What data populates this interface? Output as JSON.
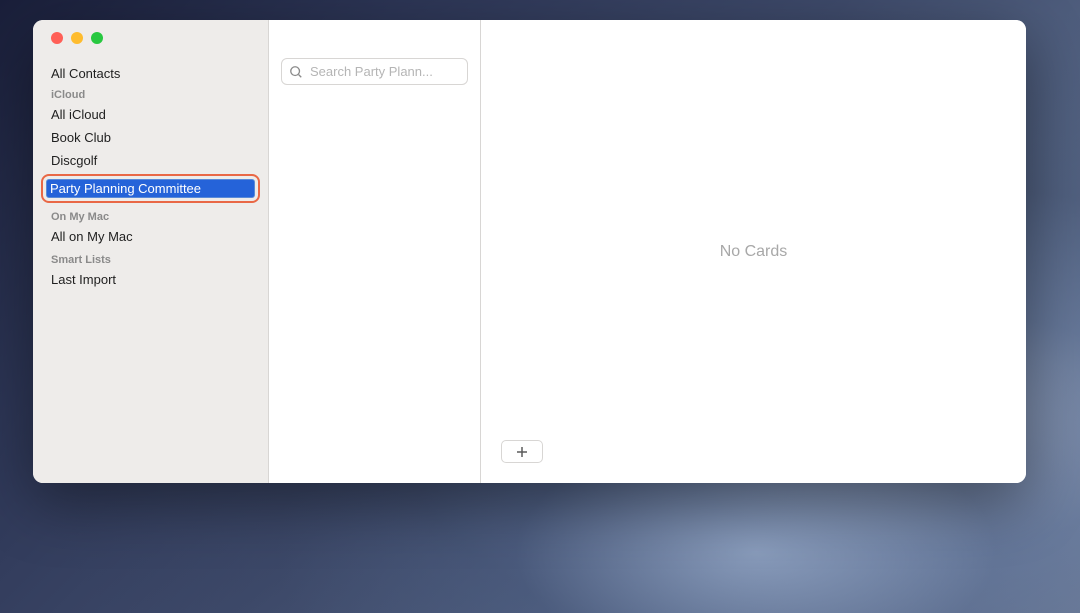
{
  "sidebar": {
    "all_contacts": "All Contacts",
    "sections": {
      "icloud": {
        "header": "iCloud",
        "items": [
          "All iCloud",
          "Book Club",
          "Discgolf"
        ],
        "editing_value": "Party Planning Committee"
      },
      "on_my_mac": {
        "header": "On My Mac",
        "items": [
          "All on My Mac"
        ]
      },
      "smart_lists": {
        "header": "Smart Lists",
        "items": [
          "Last Import"
        ]
      }
    }
  },
  "search": {
    "placeholder": "Search Party Plann..."
  },
  "detail": {
    "empty_message": "No Cards"
  }
}
